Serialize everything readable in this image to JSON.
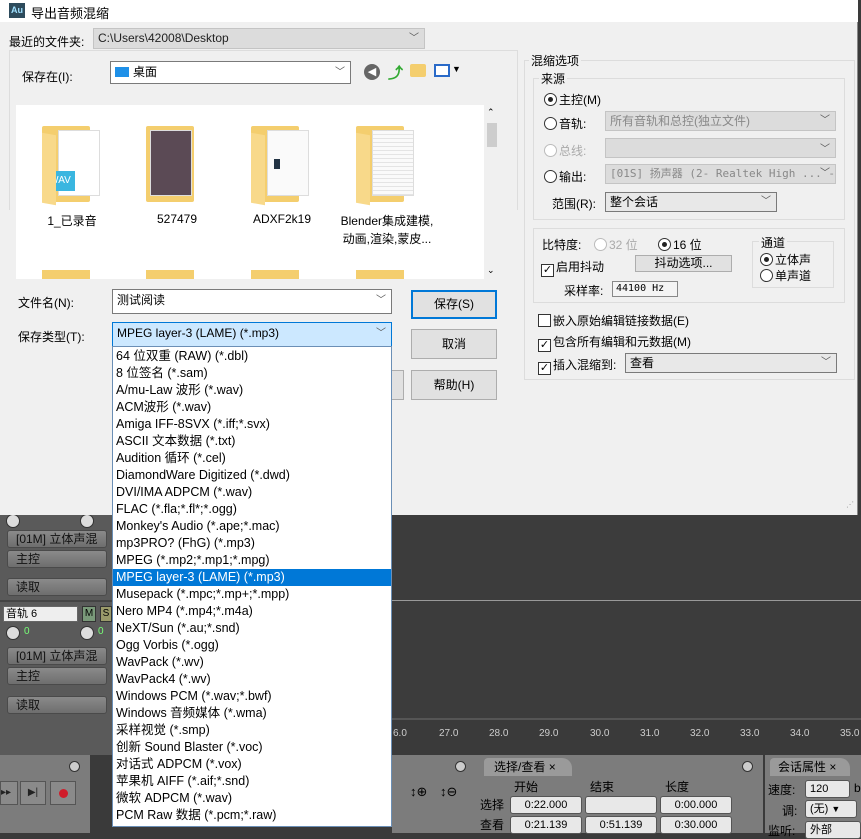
{
  "dialog": {
    "title": "导出音频混缩",
    "app_icon": "Au",
    "recent_label": "最近的文件夹:",
    "recent_value": "C:\\Users\\42008\\Desktop",
    "save_in_label": "保存在(I):",
    "save_in_value": "桌面",
    "files": [
      {
        "name": "1_已录音"
      },
      {
        "name": "527479"
      },
      {
        "name": "ADXF2k19"
      },
      {
        "name": "Blender集成建模,",
        "name2": "动画,渲染,蒙皮..."
      }
    ],
    "filename_label": "文件名(N):",
    "filename_value": "测试阅读",
    "type_label": "保存类型(T):",
    "type_value": "MPEG layer-3 (LAME) (*.mp3)",
    "save_button": "保存(S)",
    "cancel_button": "取消",
    "help_button": "帮助(H)",
    "type_options": [
      "64 位双重 (RAW) (*.dbl)",
      "8 位签名 (*.sam)",
      "A/mu-Law 波形 (*.wav)",
      "ACM波形 (*.wav)",
      "Amiga IFF-8SVX (*.iff;*.svx)",
      "ASCII 文本数据 (*.txt)",
      "Audition 循环 (*.cel)",
      "DiamondWare Digitized (*.dwd)",
      "DVI/IMA ADPCM (*.wav)",
      "FLAC (*.fla;*.fl*;*.ogg)",
      "Monkey's Audio (*.ape;*.mac)",
      "mp3PRO? (FhG) (*.mp3)",
      "MPEG (*.mp2;*.mp1;*.mpg)",
      "MPEG layer-3 (LAME) (*.mp3)",
      "Musepack (*.mpc;*.mp+;*.mpp)",
      "Nero MP4 (*.mp4;*.m4a)",
      "NeXT/Sun (*.au;*.snd)",
      "Ogg Vorbis (*.ogg)",
      "WavPack (*.wv)",
      "WavPack4 (*.wv)",
      "Windows PCM (*.wav;*.bwf)",
      "Windows 音频媒体 (*.wma)",
      "采样视觉 (*.smp)",
      "创新 Sound Blaster (*.voc)",
      "对话式 ADPCM (*.vox)",
      "苹果机 AIFF (*.aif;*.snd)",
      "微软 ADPCM (*.wav)",
      "PCM Raw 数据 (*.pcm;*.raw)"
    ],
    "selected_index": 13
  },
  "mix": {
    "title": "混缩选项",
    "source_title": "来源",
    "master": "主控(M)",
    "track": "音轨:",
    "track_value": "所有音轨和总控(独立文件)",
    "bus": "总线:",
    "output": "输出:",
    "output_value": "[01S] 扬声器 (2- Realtek High ... -",
    "range_label": "范围(R):",
    "range_value": "整个会话",
    "bitdepth_label": "比特度:",
    "bit32": "32 位",
    "bit16": "16 位",
    "dither": "启用抖动",
    "dither_options": "抖动选项...",
    "samplerate_label": "采样率:",
    "samplerate_value": "44100 Hz",
    "channel_title": "通道",
    "stereo": "立体声",
    "mono": "单声道",
    "embed": "嵌入原始编辑链接数据(E)",
    "include": "包含所有编辑和元数据(M)",
    "insert": "插入混缩到:",
    "insert_value": "查看"
  },
  "tracks": {
    "out1": "[01M] 立体声混",
    "master1": "主控",
    "read1": "读取",
    "track_name": "音轨 6",
    "mute": "M",
    "solo": "S",
    "knob_value": "0",
    "out2": "[01M] 立体声混",
    "master2": "主控",
    "read2": "读取"
  },
  "ruler": [
    "6.0",
    "27.0",
    "28.0",
    "29.0",
    "30.0",
    "31.0",
    "32.0",
    "33.0",
    "34.0",
    "35.0"
  ],
  "selection": {
    "tab": "选择/查看",
    "start": "开始",
    "end": "结束",
    "length": "长度",
    "sel_label": "选择",
    "view_label": "查看",
    "sel_start": "0:22.000",
    "sel_end": "",
    "sel_length": "0:00.000",
    "view_start": "0:21.139",
    "view_end": "0:51.139",
    "view_length": "0:30.000"
  },
  "session": {
    "tab": "会话属性",
    "tempo_label": "速度:",
    "tempo_value": "120",
    "tempo_unit": "b",
    "key_label": "调:",
    "key_value": "(无)",
    "monitor_label": "监听:",
    "monitor_value": "外部"
  }
}
